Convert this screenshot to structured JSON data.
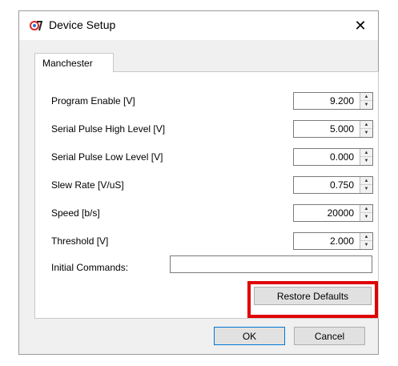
{
  "window": {
    "title": "Device Setup",
    "close_glyph": "✕"
  },
  "tabs": [
    {
      "label": "Manchester"
    }
  ],
  "fields": [
    {
      "label": "Program Enable [V]",
      "value": "9.200"
    },
    {
      "label": "Serial Pulse High Level [V]",
      "value": "5.000"
    },
    {
      "label": "Serial Pulse Low Level [V]",
      "value": "0.000"
    },
    {
      "label": "Slew Rate [V/uS]",
      "value": "0.750"
    },
    {
      "label": "Speed [b/s]",
      "value": "20000"
    },
    {
      "label": "Threshold [V]",
      "value": "2.000"
    }
  ],
  "initial_commands": {
    "label": "Initial Commands:",
    "value": ""
  },
  "buttons": {
    "restore_defaults": "Restore Defaults",
    "ok": "OK",
    "cancel": "Cancel"
  },
  "highlight_color": "#e00000"
}
